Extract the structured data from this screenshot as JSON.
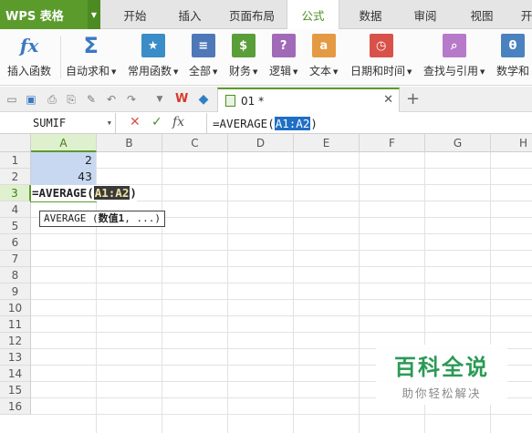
{
  "app": {
    "logo": "WPS 表格"
  },
  "menu": {
    "tabs": [
      "开始",
      "插入",
      "页面布局",
      "公式",
      "数据",
      "审阅",
      "视图",
      "开"
    ],
    "active": "公式"
  },
  "ribbon": {
    "buttons": [
      {
        "label": "插入函数",
        "icon_text": "fx",
        "color": "#3a78c2"
      },
      {
        "label": "自动求和",
        "icon_text": "Σ",
        "color": "#3a78c2"
      },
      {
        "label": "常用函数",
        "icon_text": "★",
        "color": "#3a8dc6"
      },
      {
        "label": "全部",
        "icon_text": "≡",
        "color": "#4e78b8"
      },
      {
        "label": "财务",
        "icon_text": "$",
        "color": "#5a9e3a"
      },
      {
        "label": "逻辑",
        "icon_text": "?",
        "color": "#a06ab8"
      },
      {
        "label": "文本",
        "icon_text": "a",
        "color": "#e49a43"
      },
      {
        "label": "日期和时间",
        "icon_text": "◷",
        "color": "#d8524a"
      },
      {
        "label": "查找与引用",
        "icon_text": "⌕",
        "color": "#b77ac8"
      },
      {
        "label": "数学和",
        "icon_text": "θ",
        "color": "#4a82c0"
      }
    ]
  },
  "document": {
    "tab_name": "01 *"
  },
  "formula_bar": {
    "name_box": "SUMIF",
    "cancel": "✕",
    "confirm": "✓",
    "fx": "fx",
    "formula_prefix": "=AVERAGE(",
    "formula_range": "A1:A2",
    "formula_suffix": ")"
  },
  "grid": {
    "columns": [
      "A",
      "B",
      "C",
      "D",
      "E",
      "F",
      "G",
      "H"
    ],
    "rows": [
      "1",
      "2",
      "3",
      "4",
      "5",
      "6",
      "7",
      "8",
      "9",
      "10",
      "11",
      "12",
      "13",
      "14",
      "15",
      "16"
    ],
    "active_column": "A",
    "active_row": "3",
    "cells": {
      "A1": "2",
      "A2": "43"
    },
    "edit_prefix": "=AVERAGE(",
    "edit_range": "A1:A2",
    "edit_suffix": ")",
    "tooltip_prefix": "AVERAGE (",
    "tooltip_arg": "数值1",
    "tooltip_suffix": ", ...)"
  },
  "watermark": {
    "title": "百科全说",
    "subtitle": "助你轻松解决"
  },
  "colors": {
    "brand": "#5b9b2c",
    "selection": "#c8d8f0",
    "formula_highlight": "#1f6fc4"
  }
}
